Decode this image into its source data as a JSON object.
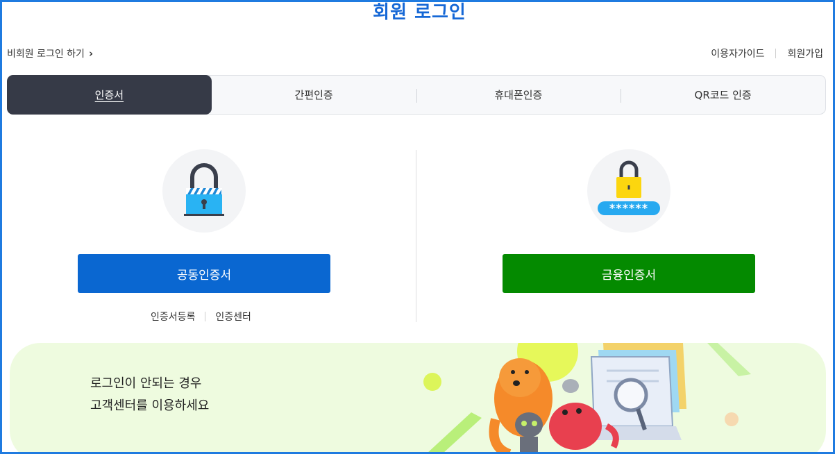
{
  "header": {
    "title": "회원 로그인"
  },
  "topnav": {
    "guest_login": "비회원 로그인 하기",
    "guide": "이용자가이드",
    "signup": "회원가입"
  },
  "tabs": [
    {
      "label": "인증서",
      "active": true
    },
    {
      "label": "간편인증",
      "active": false
    },
    {
      "label": "휴대폰인증",
      "active": false
    },
    {
      "label": "QR코드 인증",
      "active": false
    }
  ],
  "login_options": {
    "joint_cert": {
      "icon": "padlock-icon",
      "button_label": "공동인증서",
      "color": "#0a67d1"
    },
    "financial_cert": {
      "icon": "padlock-password-icon",
      "password_mask": "******",
      "button_label": "금융인증서",
      "color": "#048a00"
    },
    "sublinks": [
      "인증서등록",
      "인증센터"
    ]
  },
  "banner": {
    "line1": "로그인이 안되는 경우",
    "line2": "고객센터를 이용하세요"
  }
}
